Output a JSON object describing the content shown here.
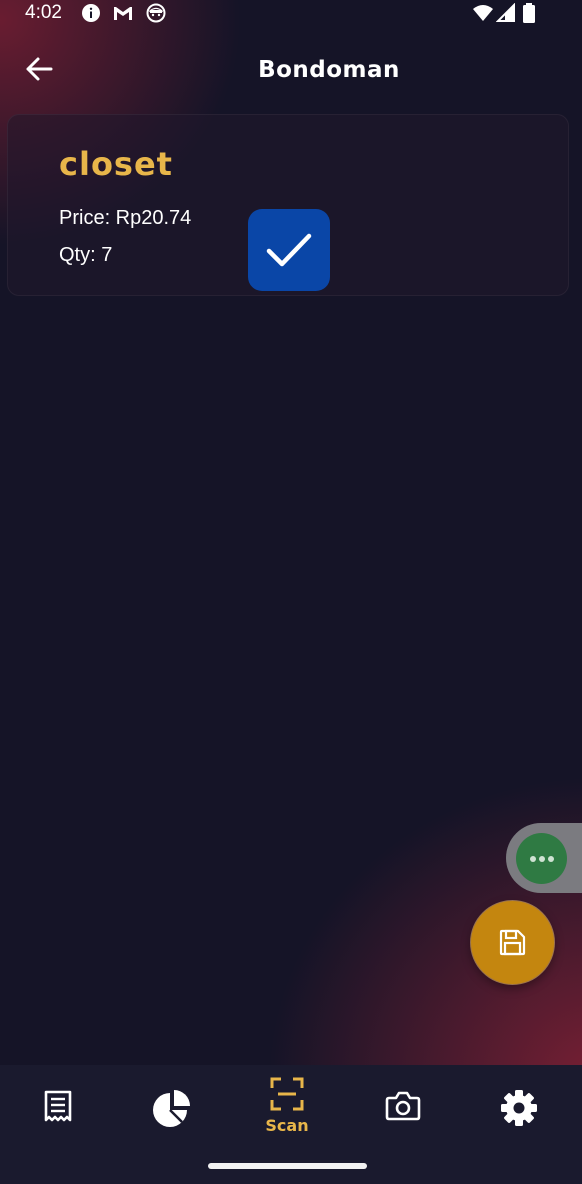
{
  "status_bar": {
    "time": "4:02",
    "left_icons": [
      "info-icon",
      "gmail-icon",
      "face-icon"
    ],
    "right_icons": [
      "wifi-icon",
      "cell-signal-icon",
      "battery-icon"
    ]
  },
  "app_bar": {
    "title": "Bondoman",
    "back_icon": "arrow-back-icon"
  },
  "item": {
    "name": "closet",
    "price": "Price: Rp20.74",
    "qty": "Qty: 7",
    "checked": true
  },
  "floating": {
    "bubble_icon": "more-horiz-icon",
    "fab_icon": "save-icon"
  },
  "bottom_nav": {
    "items": [
      {
        "icon": "receipt-icon",
        "label": ""
      },
      {
        "icon": "pie-chart-icon",
        "label": ""
      },
      {
        "icon": "scan-icon",
        "label": "Scan",
        "active": true
      },
      {
        "icon": "camera-icon",
        "label": ""
      },
      {
        "icon": "settings-icon",
        "label": ""
      }
    ]
  },
  "colors": {
    "background": "#151427",
    "accent": "#e8b64a",
    "check_button": "#0a46a7",
    "fab": "#c4860f",
    "bubble": "#2f7a43",
    "nav_background": "#1a1a2e"
  }
}
